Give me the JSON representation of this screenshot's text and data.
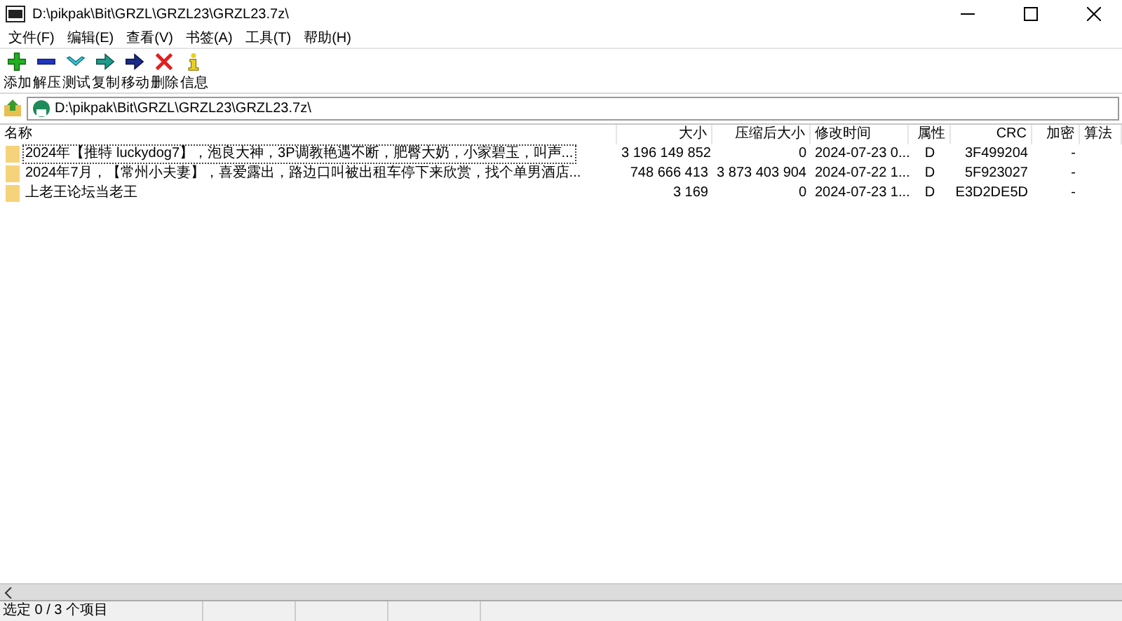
{
  "window": {
    "title": "D:\\pikpak\\Bit\\GRZL\\GRZL23\\GRZL23.7z\\"
  },
  "menu": [
    "文件(F)",
    "编辑(E)",
    "查看(V)",
    "书签(A)",
    "工具(T)",
    "帮助(H)"
  ],
  "toolbar": [
    {
      "kind": "add",
      "label": "添加"
    },
    {
      "kind": "extract",
      "label": "解压"
    },
    {
      "kind": "test",
      "label": "测试"
    },
    {
      "kind": "copy",
      "label": "复制"
    },
    {
      "kind": "move",
      "label": "移动"
    },
    {
      "kind": "delete",
      "label": "删除"
    },
    {
      "kind": "info",
      "label": "信息"
    }
  ],
  "address": {
    "value": "D:\\pikpak\\Bit\\GRZL\\GRZL23\\GRZL23.7z\\"
  },
  "table": {
    "columns": [
      "名称",
      "大小",
      "压缩后大小",
      "修改时间",
      "属性",
      "CRC",
      "加密",
      "算法"
    ],
    "rows": [
      {
        "selected": false,
        "focused": true,
        "cells": [
          "2024年【推特 luckydog7】，泡良大神，3P调教艳遇不断，肥臀大奶，小家碧玉，叫声...",
          "3 196 149 852",
          "0",
          "2024-07-23 0...",
          "D",
          "3F499204",
          "-",
          ""
        ]
      },
      {
        "selected": false,
        "focused": false,
        "cells": [
          "2024年7月，【常州小夫妻】，喜爱露出，路边口叫被出租车停下来欣赏，找个单男酒店...",
          "748 666 413",
          "3 873 403 904",
          "2024-07-22 1...",
          "D",
          "5F923027",
          "-",
          ""
        ]
      },
      {
        "selected": false,
        "focused": false,
        "cells": [
          "上老王论坛当老王",
          "3 169",
          "0",
          "2024-07-23 1...",
          "D",
          "E3D2DE5D",
          "-",
          ""
        ]
      }
    ]
  },
  "status_bar": {
    "text": "选定 0 / 3 个项目"
  }
}
